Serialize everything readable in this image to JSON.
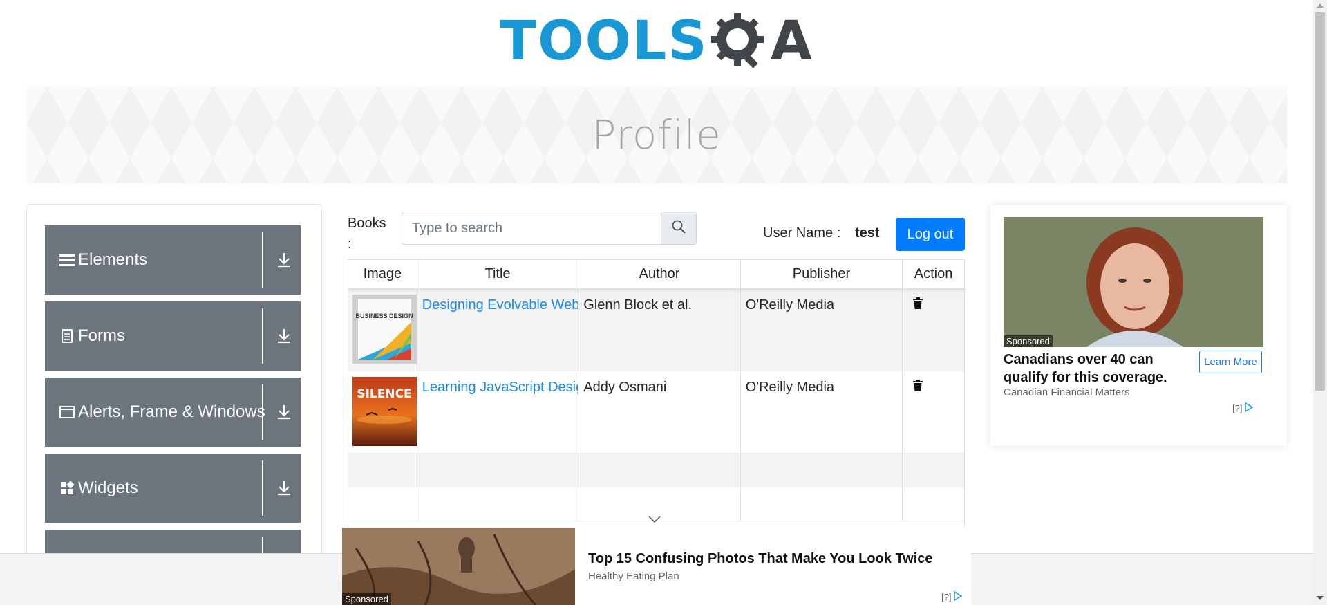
{
  "header": {
    "logo_part1": "TOOLS",
    "logo_part2": "A",
    "logo_alt": "TOOLSQA"
  },
  "banner": {
    "title": "Profile"
  },
  "sidebar": {
    "items": [
      {
        "label": "Elements",
        "icon": "hamburger-icon"
      },
      {
        "label": "Forms",
        "icon": "document-icon"
      },
      {
        "label": "Alerts, Frame & Windows",
        "icon": "window-icon"
      },
      {
        "label": "Widgets",
        "icon": "widgets-icon"
      },
      {
        "label": "",
        "icon": ""
      }
    ]
  },
  "books": {
    "label": "Books :",
    "search_placeholder": "Type to search",
    "search_value": ""
  },
  "user": {
    "label": "User Name :",
    "name": "test",
    "logout_label": "Log out"
  },
  "table": {
    "columns": [
      "Image",
      "Title",
      "Author",
      "Publisher",
      "Action"
    ],
    "rows": [
      {
        "title": "Designing Evolvable Web APIs with ASP.NET",
        "author": "Glenn Block et al.",
        "publisher": "O'Reilly Media",
        "cover_text": "BUSINESS DESIGN"
      },
      {
        "title": "Learning JavaScript Design Patterns",
        "author": "Addy Osmani",
        "publisher": "O'Reilly Media",
        "cover_text": "SILENCE"
      }
    ]
  },
  "ad_right": {
    "sponsored": "Sponsored",
    "headline": "Canadians over 40 can qualify for this coverage.",
    "cta": "Learn More",
    "source": "Canadian Financial Matters",
    "choice": "[?]"
  },
  "ad_bottom": {
    "sponsored": "Sponsored",
    "headline": "Top 15 Confusing Photos That Make You Look Twice",
    "source": "Healthy Eating Plan",
    "choice": "[?]"
  },
  "colors": {
    "accent": "#007bff",
    "brand_blue": "#1a98d5",
    "sidebar_bg": "#6c757d",
    "link": "#1a8ae8"
  }
}
